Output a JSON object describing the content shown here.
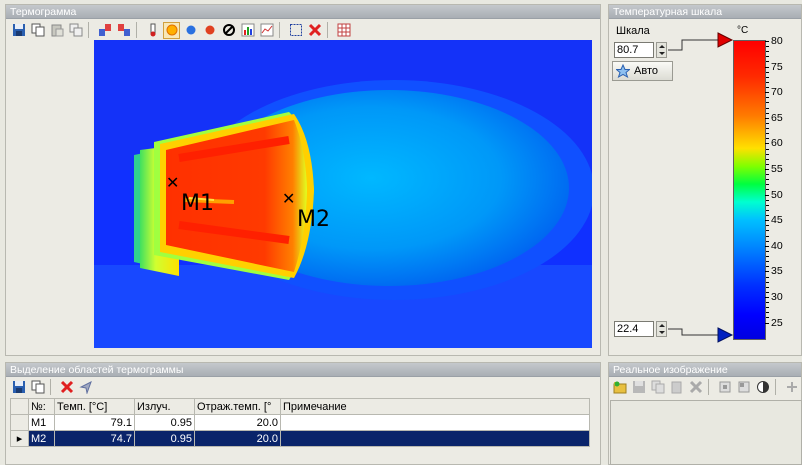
{
  "thermogram_panel": {
    "title": "Термограмма"
  },
  "thermogram": {
    "markers": [
      {
        "label": "M1"
      },
      {
        "label": "M2"
      }
    ]
  },
  "scale_panel": {
    "title": "Температурная шкала",
    "scale_label": "Шкала",
    "max_value": "80.7",
    "min_value": "22.4",
    "auto_button": "Авто",
    "unit": "°C",
    "ticks": [
      "80",
      "75",
      "70",
      "65",
      "60",
      "55",
      "50",
      "45",
      "40",
      "35",
      "30",
      "25"
    ]
  },
  "regions_panel": {
    "title": "Выделение областей термограммы",
    "columns": [
      "№:",
      "Темп. [°C]",
      "Излуч.",
      "Отраж.темп. [°",
      "Примечание"
    ],
    "rows": [
      {
        "id": "M1",
        "temp": "79.1",
        "emiss": "0.95",
        "refl": "20.0",
        "note": ""
      },
      {
        "id": "M2",
        "temp": "74.7",
        "emiss": "0.95",
        "refl": "20.0",
        "note": ""
      }
    ]
  },
  "realimage_panel": {
    "title": "Реальное изображение"
  }
}
